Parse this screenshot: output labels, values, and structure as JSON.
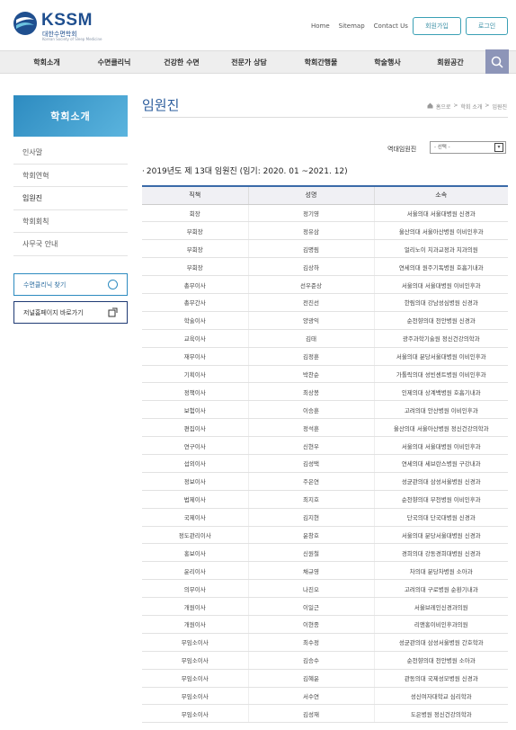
{
  "header": {
    "logo_title": "KSSM",
    "logo_subtitle": "대한수면학회",
    "logo_english": "Korean Society of Sleep Medicine",
    "top_links": [
      "Home",
      "Sitemap",
      "Contact Us"
    ],
    "join_label": "회원가입",
    "login_label": "로그인"
  },
  "nav": {
    "items": [
      "학회소개",
      "수면클리닉",
      "건강한 수면",
      "전문가 상담",
      "학회간행물",
      "학술행사",
      "회원공간"
    ]
  },
  "sidebar": {
    "banner": "학회소개",
    "items": [
      "인사말",
      "학회연혁",
      "임원진",
      "학회회칙",
      "사무국 안내"
    ],
    "clinic_button": "수면클리닉 찾기",
    "home_button": "저널홈페이지 바로가기"
  },
  "main": {
    "title": "임원진",
    "breadcrumb": [
      "홈으로",
      ">",
      "학회 소개",
      ">",
      "임원진"
    ],
    "select_label": "역대임원진",
    "select_value": "- 선택 -",
    "section_title": "2019년도 제 13대 임원진 (임기: 2020. 01 ~2021. 12)",
    "table_headers": [
      "직책",
      "성명",
      "소속"
    ],
    "rows": [
      [
        "회장",
        "정기영",
        "서울의대 서울대병원 신경과"
      ],
      [
        "부회장",
        "정유삼",
        "울산의대 서울아산병원 이비인후과"
      ],
      [
        "부회장",
        "김명림",
        "얼리노이 치과교정과 치과의원"
      ],
      [
        "부회장",
        "김상하",
        "연세의대 원주기독병원 호흡기내과"
      ],
      [
        "총무이사",
        "선우준상",
        "서울의대 서울대병원 이비인후과"
      ],
      [
        "총무간사",
        "전진선",
        "한림의대 강남성심병원 신경과"
      ],
      [
        "학술이사",
        "양광익",
        "순천향의대 천안병원 신경과"
      ],
      [
        "교육이사",
        "김태",
        "광주과학기술원 정신건강의학과"
      ],
      [
        "재무이사",
        "김정훈",
        "서울의대 분당서울대병원 이비인후과"
      ],
      [
        "기획이사",
        "박찬순",
        "가톨릭의대 성빈센트병원 이비인후과"
      ],
      [
        "정책이사",
        "최상봉",
        "인제의대 상계백병원 호흡기내과"
      ],
      [
        "보험이사",
        "이승훈",
        "고려의대 안산병원 이비인후과"
      ],
      [
        "편집이사",
        "정석훈",
        "울산의대 서울아산병원 정신건강의학과"
      ],
      [
        "연구이사",
        "신현우",
        "서울의대 서울대병원 이비인후과"
      ],
      [
        "섭외이사",
        "김성택",
        "연세의대 세브란스병원 구강내과"
      ],
      [
        "정보이사",
        "주은연",
        "성균관의대 삼성서울병원 신경과"
      ],
      [
        "법제이사",
        "최지호",
        "순천향의대 부천병원 이비인후과"
      ],
      [
        "국제이사",
        "김지현",
        "단국의대 단국대병원 신경과"
      ],
      [
        "정도관리이사",
        "윤창호",
        "서울의대 분당서울대병원 신경과"
      ],
      [
        "홍보이사",
        "신원철",
        "경희의대 강동경희대병원 신경과"
      ],
      [
        "윤리이사",
        "채규영",
        "차의대 분당차병원 소아과"
      ],
      [
        "의무이사",
        "나진오",
        "고려의대 구로병원 순환기내과"
      ],
      [
        "개원이사",
        "이일근",
        "서울브레인신경과의원"
      ],
      [
        "개원이사",
        "이현종",
        "리앤홍이비인후과의원"
      ],
      [
        "무임소이사",
        "최수정",
        "성균관의대 삼성서울병원 간호학과"
      ],
      [
        "무임소이사",
        "김승수",
        "순천향의대 천안병원 소아과"
      ],
      [
        "무임소이사",
        "김혜윤",
        "관동의대 국제성모병원 신경과"
      ],
      [
        "무임소이사",
        "서수연",
        "성신여자대학교 심리학과"
      ],
      [
        "무임소이사",
        "김성재",
        "도은병원 정신건강의학과"
      ]
    ]
  },
  "colors": {
    "brand_blue": "#1f4f8f",
    "accent_teal": "#3aa0b5",
    "nav_bg": "#eeeeee",
    "search_bg": "#8d95b8",
    "table_top_border": "#3a6aa8"
  }
}
